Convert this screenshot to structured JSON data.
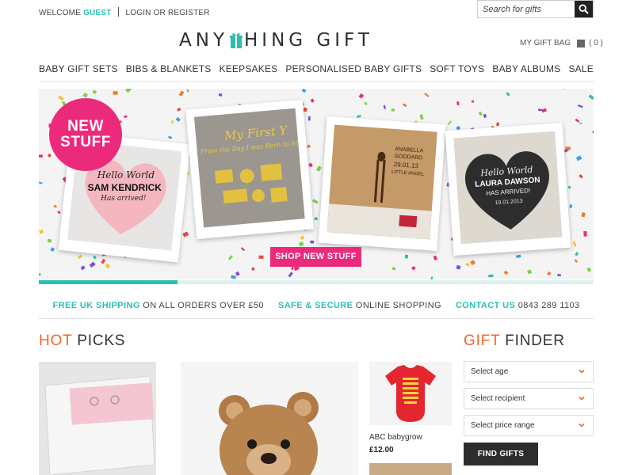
{
  "header": {
    "welcome_prefix": "WELCOME",
    "welcome_user": "GUEST",
    "login_link": "LOGIN OR REGISTER",
    "search_placeholder": "Search for gifts",
    "logo_left": "ANY",
    "logo_right": "HING GIFT",
    "gift_bag_label": "MY GIFT BAG",
    "gift_bag_count": "( 0 )"
  },
  "nav": {
    "items": [
      {
        "label": "BABY GIFT SETS"
      },
      {
        "label": "BIBS & BLANKETS"
      },
      {
        "label": "KEEPSAKES"
      },
      {
        "label": "PERSONALISED BABY GIFTS"
      },
      {
        "label": "SOFT TOYS"
      },
      {
        "label": "BABY ALBUMS"
      },
      {
        "label": "SALE"
      }
    ]
  },
  "hero": {
    "badge_line1": "NEW",
    "badge_line2": "STUFF",
    "cta": "SHOP NEW STUFF",
    "card1": {
      "line1": "Hello World",
      "line2": "SAM KENDRICK",
      "line3": "Has arrived!"
    },
    "card2": {
      "line1": "My First Y",
      "line2": "From the Day I was Born to My"
    },
    "card3": {
      "line1": "ANABELLA",
      "line2": "GODDARD",
      "line3": "29.01.13",
      "line4": "LITTLE ANGEL"
    },
    "card4": {
      "line1": "Hello World",
      "line2": "LAURA DAWSON",
      "line3": "HAS ARRIVED!",
      "line4": "19.01.2013"
    },
    "progress": 0.25,
    "colors": {
      "accent": "#ec2a7b",
      "teal": "#2bbfb1"
    }
  },
  "info": {
    "shipping_hl": "FREE UK SHIPPING",
    "shipping_text": "ON ALL ORDERS OVER £50",
    "secure_hl": "SAFE & SECURE",
    "secure_text": "ONLINE SHOPPING",
    "contact_hl": "CONTACT US",
    "contact_text": "0843 289 1103"
  },
  "hot_picks": {
    "title_accent": "HOT",
    "title_rest": "PICKS",
    "products": [
      {
        "name": "ABC babygrow",
        "price": "£12.00"
      }
    ]
  },
  "gift_finder": {
    "title_accent": "GIFT",
    "title_rest": "FINDER",
    "selects": [
      {
        "label": "Select age"
      },
      {
        "label": "Select recipient"
      },
      {
        "label": "Select price range"
      }
    ],
    "button": "FIND GIFTS"
  },
  "colors": {
    "teal": "#2bbfb1",
    "pink": "#ec2a7b",
    "orange": "#f0662b",
    "dark": "#2d2d2d"
  }
}
